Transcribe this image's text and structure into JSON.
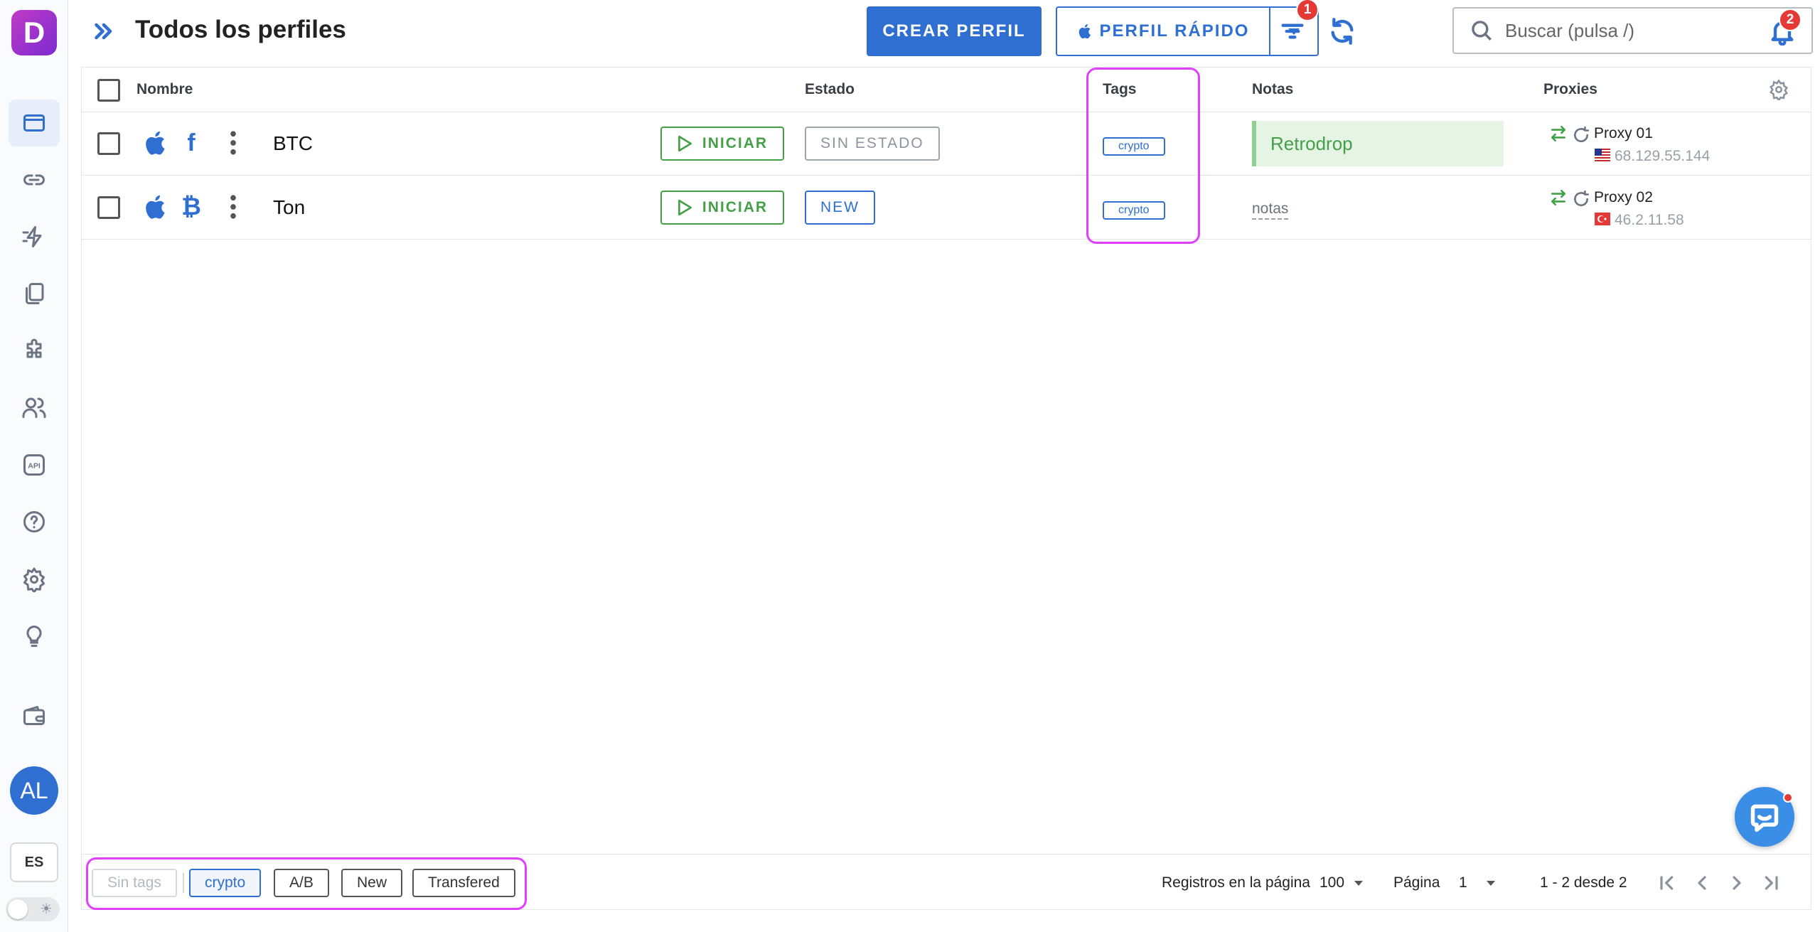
{
  "sidebar": {
    "logo_letter": "D",
    "items": [
      {
        "name": "profiles-icon",
        "active": true
      },
      {
        "name": "link-icon"
      },
      {
        "name": "automation-icon"
      },
      {
        "name": "copy-icon"
      },
      {
        "name": "extension-icon"
      },
      {
        "name": "team-icon"
      },
      {
        "name": "api-icon",
        "text": "API"
      },
      {
        "name": "help-icon"
      },
      {
        "name": "settings-icon"
      },
      {
        "name": "lightbulb-icon"
      },
      {
        "name": "wallet-icon"
      }
    ],
    "avatar_initials": "AL",
    "language": "ES"
  },
  "header": {
    "title": "Todos los perfiles",
    "create_label": "CREAR PERFIL",
    "quick_label": "PERFIL RÁPIDO",
    "filter_badge": "1",
    "search_placeholder": "Buscar (pulsa /)",
    "notifications_badge": "2"
  },
  "table": {
    "columns": {
      "name": "Nombre",
      "status": "Estado",
      "tags": "Tags",
      "notes": "Notas",
      "proxies": "Proxies"
    },
    "start_label": "INICIAR",
    "rows": [
      {
        "os_icon": "apple-icon",
        "brand_icon": "facebook-icon",
        "brand_glyph": "f",
        "name": "BTC",
        "status": "SIN ESTADO",
        "status_color": "#8d949b",
        "tag": "crypto",
        "note": "Retrodrop",
        "proxy_name": "Proxy 01",
        "proxy_ip": "68.129.55.144",
        "flag": "us-flag-icon"
      },
      {
        "os_icon": "apple-icon",
        "brand_icon": "bitcoin-icon",
        "brand_glyph": "₿",
        "name": "Ton",
        "status": "NEW",
        "status_color": "#2f6fd1",
        "tag": "crypto",
        "note_placeholder": "notas",
        "proxy_name": "Proxy 02",
        "proxy_ip": "46.2.11.58",
        "flag": "tr-flag-icon"
      }
    ]
  },
  "footer": {
    "tag_filters": [
      {
        "label": "Sin tags",
        "state": "disabled"
      },
      {
        "label": "crypto",
        "state": "active"
      },
      {
        "label": "A/B",
        "state": "normal"
      },
      {
        "label": "New",
        "state": "normal"
      },
      {
        "label": "Transfered",
        "state": "normal"
      }
    ],
    "rows_per_page_label": "Registros en la página",
    "rows_per_page_value": "100",
    "page_label": "Página",
    "page_value": "1",
    "range_text": "1 - 2 desde 2"
  },
  "colors": {
    "accent": "#2f6fd1",
    "success": "#43a047",
    "highlight": "#e040fb",
    "badge": "#e53935"
  }
}
